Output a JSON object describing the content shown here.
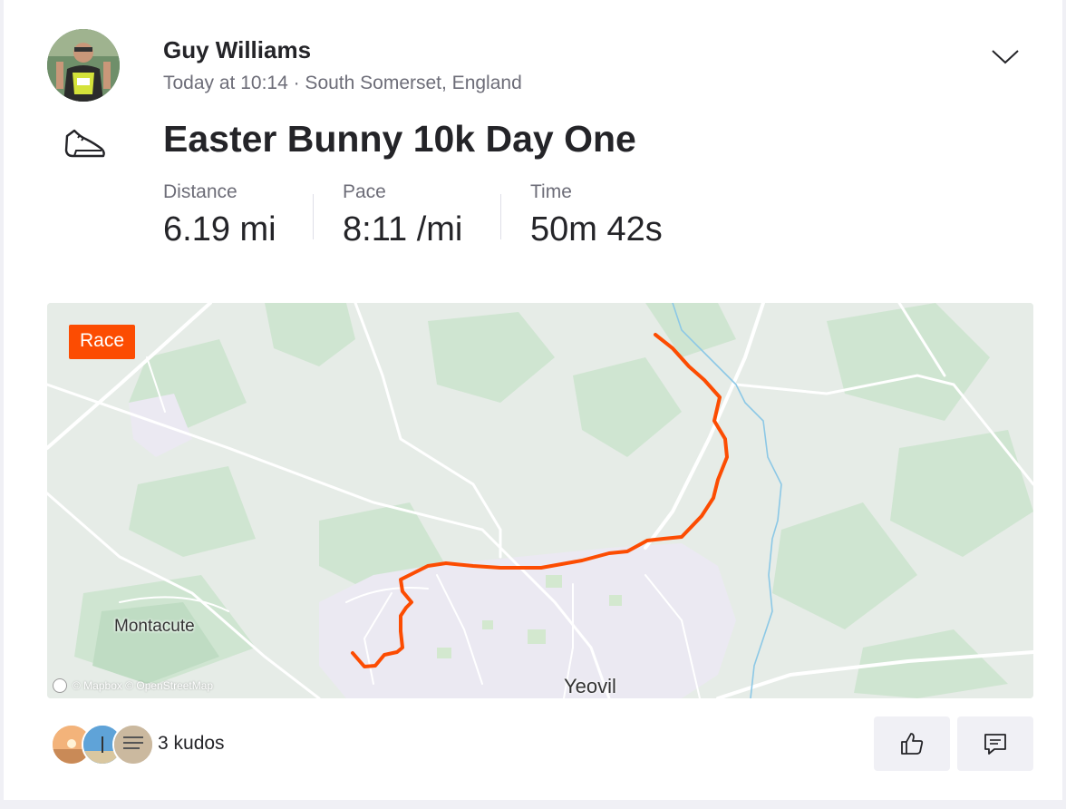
{
  "activity": {
    "athlete_name": "Guy Williams",
    "meta": "Today at 10:14 · South Somerset, England",
    "sport_icon": "shoe-icon",
    "title": "Easter Bunny 10k Day One",
    "stats": [
      {
        "label": "Distance",
        "value": "6.19 mi"
      },
      {
        "label": "Pace",
        "value": "8:11 /mi"
      },
      {
        "label": "Time",
        "value": "50m 42s"
      }
    ]
  },
  "map": {
    "badge": "Race",
    "places": [
      "Montacute",
      "Yeovil"
    ],
    "attribution": "© Mapbox © OpenStreetMap",
    "route_color": "#fc4c02"
  },
  "footer": {
    "kudos_text": "3 kudos",
    "kudos_icon": "thumbs-up-icon",
    "comment_icon": "comment-icon"
  },
  "colors": {
    "accent": "#fc4c02",
    "text": "#242428",
    "muted": "#6d6d78"
  }
}
